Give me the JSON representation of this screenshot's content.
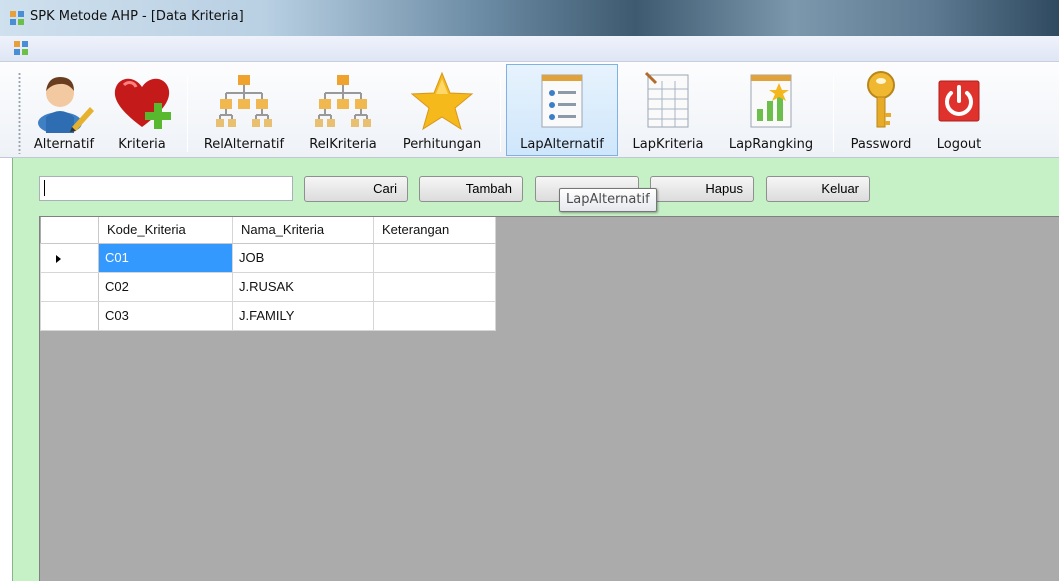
{
  "window": {
    "title": "SPK Metode AHP - [Data Kriteria]"
  },
  "toolbar": {
    "items": [
      {
        "label": "Alternatif",
        "icon": "user-edit-icon"
      },
      {
        "label": "Kriteria",
        "icon": "heart-add-icon"
      },
      {
        "label": "RelAlternatif",
        "icon": "hierarchy-icon"
      },
      {
        "label": "RelKriteria",
        "icon": "hierarchy-icon"
      },
      {
        "label": "Perhitungan",
        "icon": "star-icon"
      },
      {
        "label": "LapAlternatif",
        "icon": "report-list-icon",
        "active": true
      },
      {
        "label": "LapKriteria",
        "icon": "report-table-icon"
      },
      {
        "label": "LapRangking",
        "icon": "report-star-icon"
      },
      {
        "label": "Password",
        "icon": "key-icon"
      },
      {
        "label": "Logout",
        "icon": "power-icon"
      }
    ]
  },
  "form": {
    "search": {
      "value": "",
      "placeholder": ""
    },
    "buttons": {
      "cari": "Cari",
      "tambah": "Tambah",
      "ubah": "",
      "hapus": "Hapus",
      "keluar": "Keluar"
    },
    "tooltip": "LapAlternatif"
  },
  "grid": {
    "columns": [
      "Kode_Kriteria",
      "Nama_Kriteria",
      "Keterangan"
    ],
    "rows": [
      {
        "kode": "C01",
        "nama": "JOB",
        "keterangan": "",
        "selected": true
      },
      {
        "kode": "C02",
        "nama": "J.RUSAK",
        "keterangan": ""
      },
      {
        "kode": "C03",
        "nama": "J.FAMILY",
        "keterangan": ""
      }
    ]
  },
  "colors": {
    "form_background": "#c6f0c6",
    "grid_background": "#ababab",
    "selection": "#3399ff",
    "toolbar_active": "#cfe6fb"
  }
}
